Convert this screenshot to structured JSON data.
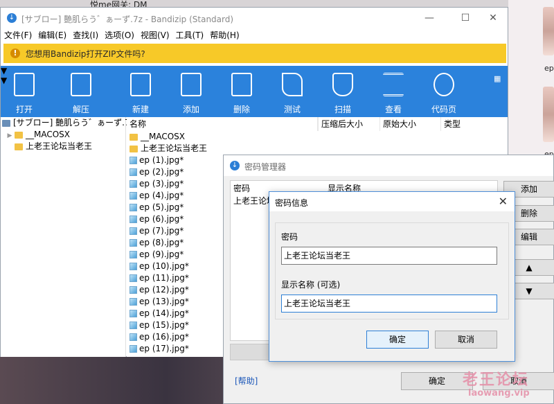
{
  "background": {
    "tab_text": "悦me网关: DM",
    "thumb_labels": [
      "ep",
      "ep"
    ]
  },
  "window": {
    "title": "[サブロー] 艷肌らう゛ぁーず.7z - Bandizip (Standard)",
    "minimize": "—",
    "maximize": "☐",
    "close": "✕"
  },
  "menu": [
    "文件(F)",
    "编辑(E)",
    "查找(I)",
    "选项(O)",
    "视图(V)",
    "工具(T)",
    "帮助(H)"
  ],
  "notice": {
    "icon": "!",
    "text": "您想用Bandizip打开ZIP文件吗?"
  },
  "toolbar": [
    {
      "label": "打开",
      "icon": "open-icon"
    },
    {
      "label": "解压",
      "icon": "extract-icon"
    },
    {
      "label": "新建",
      "icon": "new-archive-icon"
    },
    {
      "label": "添加",
      "icon": "add-icon"
    },
    {
      "label": "删除",
      "icon": "delete-icon"
    },
    {
      "label": "测试",
      "icon": "test-icon"
    },
    {
      "label": "扫描",
      "icon": "scan-icon"
    },
    {
      "label": "查看",
      "icon": "view-icon"
    },
    {
      "label": "代码页",
      "icon": "codepage-icon"
    }
  ],
  "tree": {
    "root": "[サブロー] 艷肌らう゛ぁーず.7z",
    "items": [
      "__MACOSX",
      "上老王论坛当老王"
    ]
  },
  "list": {
    "columns": {
      "name": "名称",
      "packed": "压缩后大小",
      "original": "原始大小",
      "type": "类型"
    },
    "folders": [
      "__MACOSX",
      "上老王论坛当老王"
    ],
    "files": [
      "ep (1).jpg*",
      "ep (2).jpg*",
      "ep (3).jpg*",
      "ep (4).jpg*",
      "ep (5).jpg*",
      "ep (6).jpg*",
      "ep (7).jpg*",
      "ep (8).jpg*",
      "ep (9).jpg*",
      "ep (10).jpg*",
      "ep (11).jpg*",
      "ep (12).jpg*",
      "ep (13).jpg*",
      "ep (14).jpg*",
      "ep (15).jpg*",
      "ep (16).jpg*",
      "ep (17).jpg*"
    ]
  },
  "password_manager": {
    "title": "密码管理器",
    "col_password": "密码",
    "col_display": "显示名称",
    "row_password": "上老王论坛",
    "buttons": {
      "add": "添加",
      "delete": "删除",
      "edit": "编辑",
      "up": "▲",
      "down": "▼"
    },
    "help": "[帮助]",
    "ok": "确定",
    "cancel": "取消"
  },
  "password_info": {
    "title": "密码信息",
    "password_label": "密码",
    "password_value": "上老王论坛当老王",
    "display_label": "显示名称 (可选)",
    "display_value": "上老王论坛当老王",
    "ok": "确定",
    "cancel": "取消"
  },
  "watermark": {
    "line1": "老王论坛",
    "line2": "laowang.vip"
  }
}
